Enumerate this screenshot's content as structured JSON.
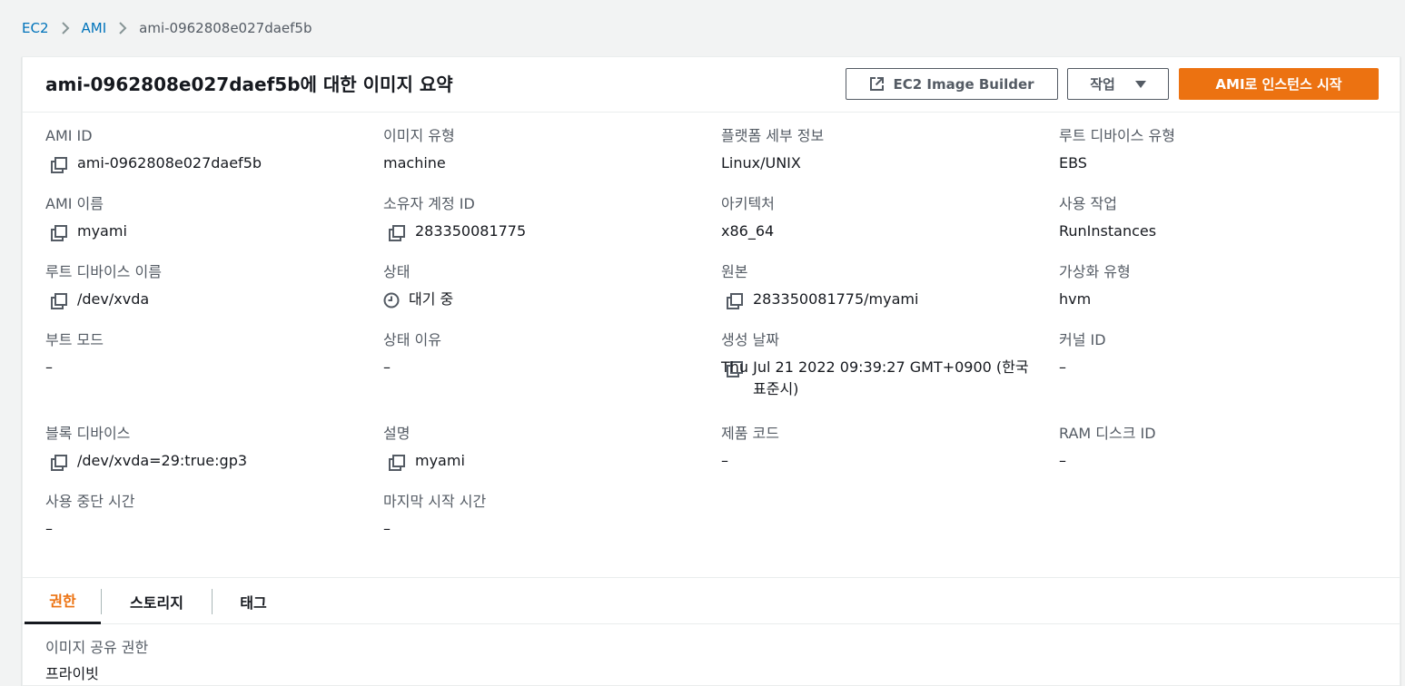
{
  "breadcrumb": {
    "items": [
      "EC2",
      "AMI",
      "ami-0962808e027daef5b"
    ]
  },
  "header": {
    "title": "ami-0962808e027daef5b에 대한 이미지 요약",
    "image_builder_label": "EC2 Image Builder",
    "actions_label": "작업",
    "launch_label": "AMI로 인스턴스 시작"
  },
  "details": {
    "ami_id": {
      "label": "AMI ID",
      "value": "ami-0962808e027daef5b"
    },
    "image_type": {
      "label": "이미지 유형",
      "value": "machine"
    },
    "platform_details": {
      "label": "플랫폼 세부 정보",
      "value": "Linux/UNIX"
    },
    "root_device_type": {
      "label": "루트 디바이스 유형",
      "value": "EBS"
    },
    "ami_name": {
      "label": "AMI 이름",
      "value": "myami"
    },
    "owner_account_id": {
      "label": "소유자 계정 ID",
      "value": "283350081775"
    },
    "architecture": {
      "label": "아키텍처",
      "value": "x86_64"
    },
    "usage_operation": {
      "label": "사용 작업",
      "value": "RunInstances"
    },
    "root_device_name": {
      "label": "루트 디바이스 이름",
      "value": "/dev/xvda"
    },
    "state": {
      "label": "상태",
      "value": "대기 중"
    },
    "source": {
      "label": "원본",
      "value": "283350081775/myami"
    },
    "virtualization_type": {
      "label": "가상화 유형",
      "value": "hvm"
    },
    "boot_mode": {
      "label": "부트 모드",
      "value": "–"
    },
    "state_reason": {
      "label": "상태 이유",
      "value": "–"
    },
    "creation_date": {
      "label": "생성 날짜",
      "value": "Thu Jul 21 2022 09:39:27 GMT+0900 (한국 표준시)"
    },
    "kernel_id": {
      "label": "커널 ID",
      "value": "–"
    },
    "block_devices": {
      "label": "블록 디바이스",
      "value": "/dev/xvda=29:true:gp3"
    },
    "description": {
      "label": "설명",
      "value": "myami"
    },
    "product_codes": {
      "label": "제품 코드",
      "value": "–"
    },
    "ramdisk_id": {
      "label": "RAM 디스크 ID",
      "value": "–"
    },
    "deprecation_time": {
      "label": "사용 중단 시간",
      "value": "–"
    },
    "last_launched_time": {
      "label": "마지막 시작 시간",
      "value": "–"
    }
  },
  "tabs": [
    {
      "label": "권한",
      "active": true
    },
    {
      "label": "스토리지",
      "active": false
    },
    {
      "label": "태그",
      "active": false
    }
  ],
  "permissions": {
    "label": "이미지 공유 권한",
    "value": "프라이빗"
  },
  "colors": {
    "primary": "#ec7211",
    "link": "#0073bb",
    "text": "#16191f",
    "muted": "#545b64"
  }
}
